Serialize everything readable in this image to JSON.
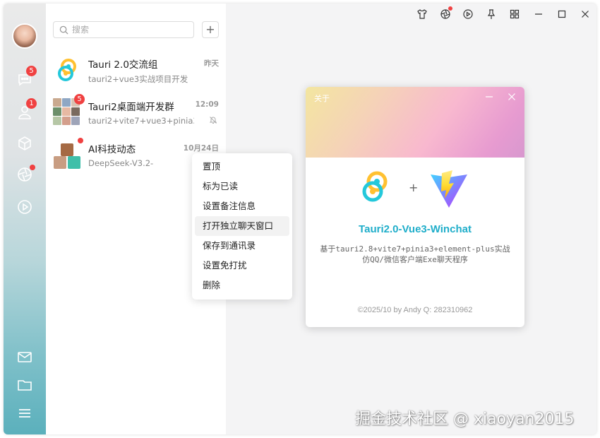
{
  "colors": {
    "badge": "#f04141",
    "accent": "#20aeca",
    "rail_top": "#eaeaea",
    "rail_bottom": "#5bb0bc"
  },
  "rail": {
    "items": [
      {
        "icon": "chat-icon",
        "badge": "5"
      },
      {
        "icon": "contacts-icon",
        "badge": "1"
      },
      {
        "icon": "cube-icon"
      },
      {
        "icon": "aperture-icon",
        "dot": true
      },
      {
        "icon": "play-circle-icon"
      },
      {
        "icon": "mail-icon"
      },
      {
        "icon": "folder-icon"
      },
      {
        "icon": "menu-icon"
      }
    ]
  },
  "search": {
    "placeholder": "搜索",
    "value": ""
  },
  "add_label": "+",
  "sessions": [
    {
      "title": "Tauri 2.0交流组",
      "time": "昨天",
      "preview": "tauri2+vue3实战项目开发"
    },
    {
      "title": "Tauri2桌面端开发群",
      "time": "12:09",
      "preview": "tauri2+vite7+vue3+pinia3...",
      "badge": "5",
      "muted": true
    },
    {
      "title": "AI科技动态",
      "time": "10月24日",
      "preview": "DeepSeek-V3.2-",
      "dot": true
    }
  ],
  "context_menu": {
    "items": [
      "置顶",
      "标为已读",
      "设置备注信息",
      "打开独立聊天窗口",
      "保存到通讯录",
      "设置免打扰",
      "删除"
    ],
    "hover_index": 3
  },
  "top_controls": [
    "shirt-icon",
    "aperture-icon",
    "play-icon",
    "pin-icon",
    "grid-icon",
    "minimize-icon",
    "maximize-icon",
    "close-icon"
  ],
  "about": {
    "title": "关于",
    "app_name": "Tauri2.0-Vue3-Winchat",
    "plus": "+",
    "description_line1": "基于tauri2.8+vite7+pinia3+element-plus实战",
    "description_line2": "仿QQ/微信客户端Exe聊天程序",
    "copyright": "©2025/10 by Andy   Q: 282310962"
  },
  "watermark": "掘金技术社区 @ xiaoyan2015"
}
